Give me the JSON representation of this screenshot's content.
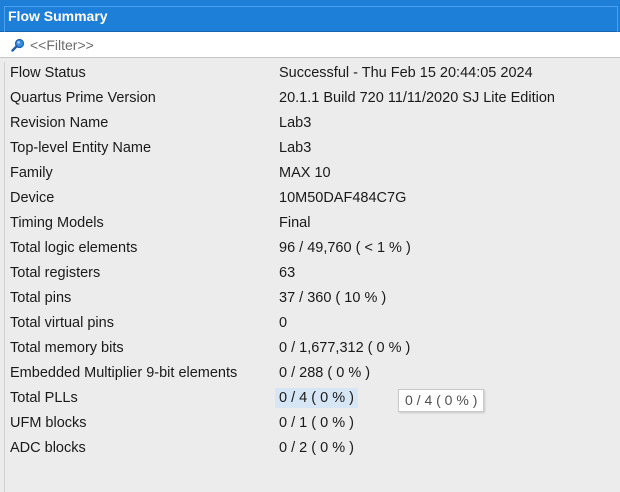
{
  "window": {
    "title": "Flow Summary"
  },
  "filter": {
    "placeholder": "<<Filter>>",
    "icon": "search-icon"
  },
  "rows": [
    {
      "key": "Flow Status",
      "value": "Successful - Thu Feb 15 20:44:05 2024"
    },
    {
      "key": "Quartus Prime Version",
      "value": "20.1.1 Build 720 11/11/2020 SJ Lite Edition"
    },
    {
      "key": "Revision Name",
      "value": "Lab3"
    },
    {
      "key": "Top-level Entity Name",
      "value": "Lab3"
    },
    {
      "key": "Family",
      "value": "MAX 10"
    },
    {
      "key": "Device",
      "value": "10M50DAF484C7G"
    },
    {
      "key": "Timing Models",
      "value": "Final"
    },
    {
      "key": "Total logic elements",
      "value": "96 / 49,760 ( < 1 % )"
    },
    {
      "key": "Total registers",
      "value": "63"
    },
    {
      "key": "Total pins",
      "value": "37 / 360 ( 10 % )"
    },
    {
      "key": "Total virtual pins",
      "value": "0"
    },
    {
      "key": "Total memory bits",
      "value": "0 / 1,677,312 ( 0 % )"
    },
    {
      "key": "Embedded Multiplier 9-bit elements",
      "value": "0 / 288 ( 0 % )"
    },
    {
      "key": "Total PLLs",
      "value": "0 / 4 ( 0 % )"
    },
    {
      "key": "UFM blocks",
      "value": "0 / 1 ( 0 % )"
    },
    {
      "key": "ADC blocks",
      "value": "0 / 2 ( 0 % )"
    }
  ],
  "tooltip": {
    "text": "0 / 4 ( 0 % )"
  },
  "colors": {
    "title_bar": "#1e7fd8",
    "selection": "#d6e6f5"
  }
}
